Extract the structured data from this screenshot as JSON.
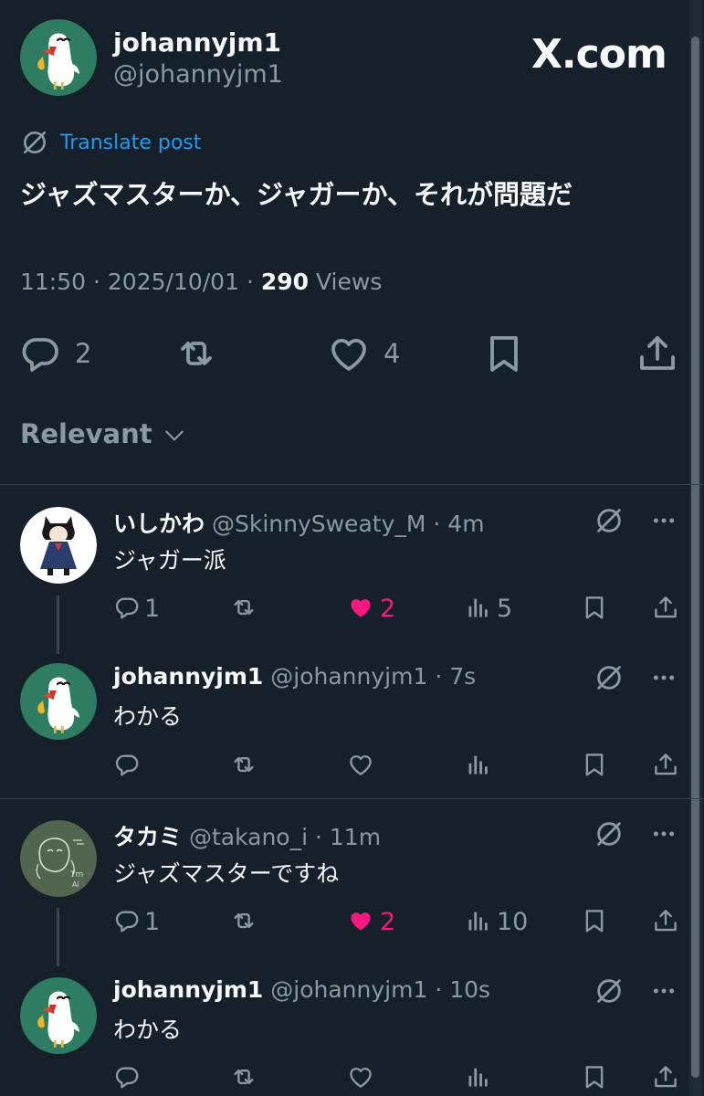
{
  "brand": {
    "logo_text": "X.com"
  },
  "post": {
    "display_name": "johannyjm1",
    "handle": "@johannyjm1",
    "translate_label": "Translate post",
    "text": "ジャズマスターか、ジャガーか、それが問題だ",
    "time": "11:50",
    "sep1": "·",
    "date": "2025/10/01",
    "sep2": "·",
    "views_count": "290",
    "views_label": "Views",
    "reply_count": "2",
    "like_count": "4"
  },
  "sort": {
    "label": "Relevant"
  },
  "replies": [
    {
      "display_name": "いしかわ",
      "handle": "@SkinnySweaty_M",
      "sep": "·",
      "age": "4m",
      "text": "ジャガー派",
      "reply_count": "1",
      "like_count": "2",
      "view_count": "5",
      "liked": true
    },
    {
      "display_name": "johannyjm1",
      "handle": "@johannyjm1",
      "sep": "·",
      "age": "7s",
      "text": "わかる"
    },
    {
      "display_name": "タカミ",
      "handle": "@takano_i",
      "sep": "·",
      "age": "11m",
      "text": "ジャズマスターですね",
      "reply_count": "1",
      "like_count": "2",
      "view_count": "10",
      "liked": true
    },
    {
      "display_name": "johannyjm1",
      "handle": "@johannyjm1",
      "sep": "·",
      "age": "10s",
      "text": "わかる"
    }
  ],
  "colors": {
    "background": "#15202b",
    "text": "#f7f9f9",
    "muted": "#8b98a5",
    "link": "#1d9bf0",
    "like": "#f91880",
    "avatar_green": "#2e7c61"
  }
}
